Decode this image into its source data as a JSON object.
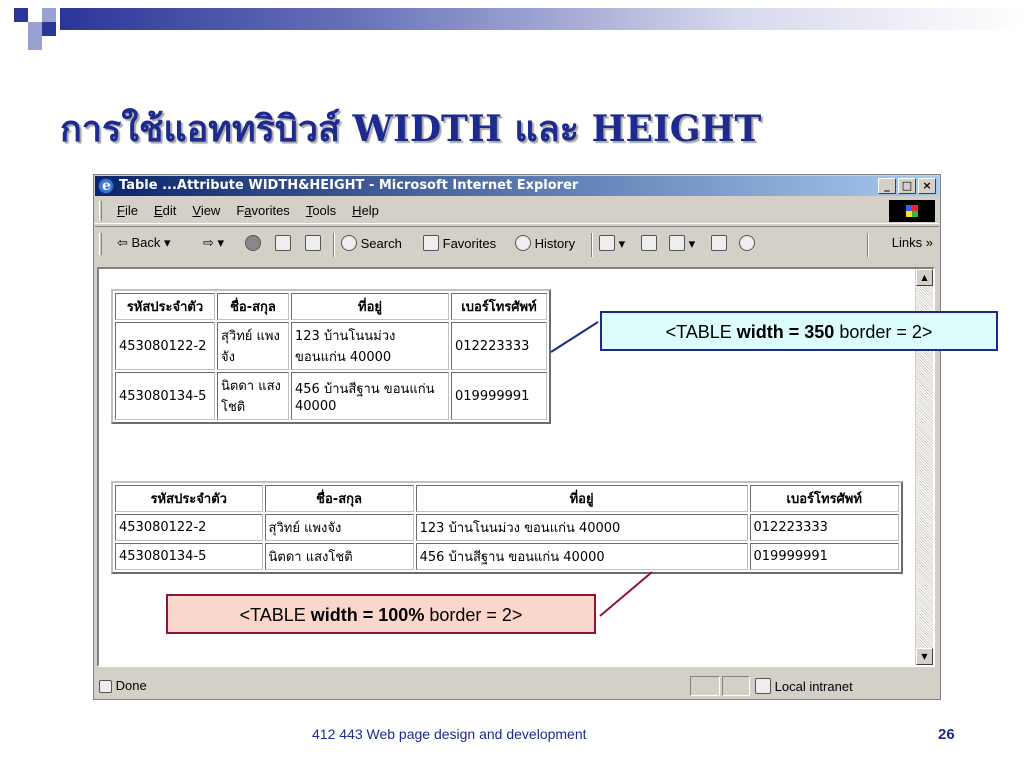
{
  "slide": {
    "title": "การใช้แอททริบิวส์  WIDTH และ HEIGHT",
    "footer": "412 443 Web page design and development",
    "page_number": "26"
  },
  "window": {
    "title": "Table ...Attribute WIDTH&HEIGHT - Microsoft Internet Explorer",
    "buttons": {
      "minimize": "_",
      "maximize": "□",
      "close": "×"
    }
  },
  "menu": [
    {
      "underline": "F",
      "rest": "ile"
    },
    {
      "underline": "E",
      "rest": "dit"
    },
    {
      "underline": "V",
      "rest": "iew"
    },
    {
      "pre": "F",
      "underline": "a",
      "rest": "vorites"
    },
    {
      "underline": "T",
      "rest": "ools"
    },
    {
      "underline": "H",
      "rest": "elp"
    }
  ],
  "toolbar": {
    "back": "⇦ Back",
    "forward": "⇨",
    "search": "Search",
    "favorites": "Favorites",
    "history": "History",
    "links": "Links »"
  },
  "table1": {
    "headers": [
      "รหัสประจำตัว",
      "ชื่อ-สกุล",
      "ที่อยู่",
      "เบอร์โทรศัพท์"
    ],
    "rows": [
      [
        "453080122-2",
        "สุวิทย์ แพงจัง",
        "123 บ้านโนนม่วง ขอนแก่น 40000",
        "012223333"
      ],
      [
        "453080134-5",
        "นิตดา แสงโชติ",
        "456 บ้านสีฐาน ขอนแก่น 40000",
        "019999991"
      ]
    ]
  },
  "table2": {
    "headers": [
      "รหัสประจำตัว",
      "ชื่อ-สกุล",
      "ที่อยู่",
      "เบอร์โทรศัพท์"
    ],
    "rows": [
      [
        "453080122-2",
        "สุวิทย์ แพงจัง",
        "123 บ้านโนนม่วง ขอนแก่น 40000",
        "012223333"
      ],
      [
        "453080134-5",
        "นิตดา แสงโชติ",
        "456 บ้านสีฐาน ขอนแก่น 40000",
        "019999991"
      ]
    ]
  },
  "callout1": {
    "pre": "<TABLE ",
    "bold": "width = 350",
    "post": "  border = 2>"
  },
  "callout2": {
    "pre": "<TABLE ",
    "bold": "width = 100%",
    "post": "  border = 2>"
  },
  "status": {
    "left": "Done",
    "zone": "Local intranet"
  },
  "colors": {
    "title": "#1d2b8f",
    "callout1_bg": "#ddfdfd",
    "callout2_bg": "#fbd7cb",
    "callout2_border": "#8b1538"
  }
}
